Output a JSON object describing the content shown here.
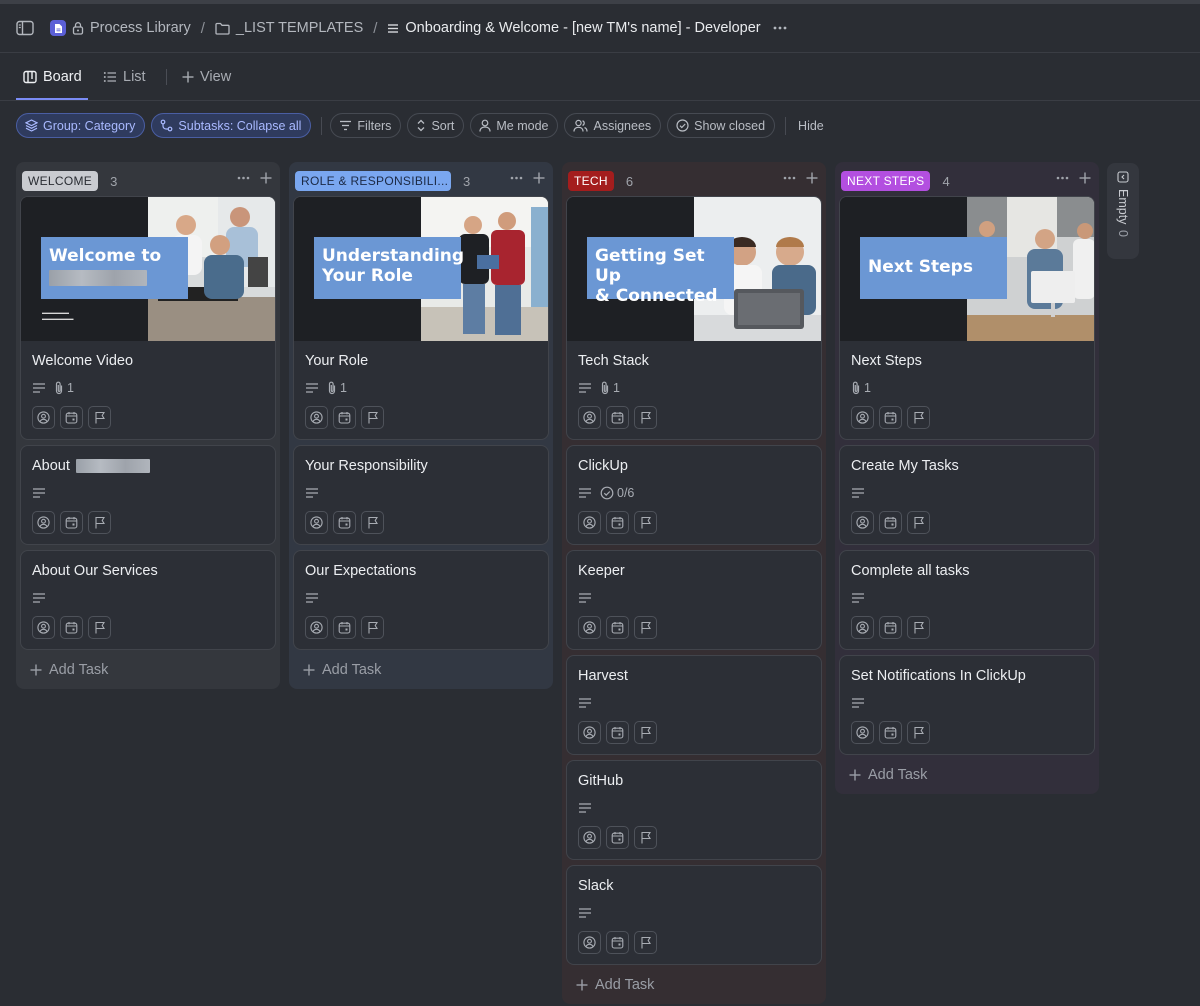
{
  "breadcrumb": {
    "space": "Process Library",
    "folder": "_LIST TEMPLATES",
    "list": "Onboarding & Welcome - [new TM's name] - Developer"
  },
  "views": {
    "board": "Board",
    "list": "List",
    "add_view": "View"
  },
  "toolbar": {
    "group": "Group: Category",
    "subtasks": "Subtasks: Collapse all",
    "filters": "Filters",
    "sort": "Sort",
    "me_mode": "Me mode",
    "assignees": "Assignees",
    "show_closed": "Show closed",
    "hide": "Hide"
  },
  "colors": {
    "accent": "#7b8cf5",
    "welcome": "#c9cbd0",
    "role": "#7aa7f0",
    "tech": "#a41d1d",
    "next_steps": "#b34fe0"
  },
  "add_task_label": "Add Task",
  "columns": [
    {
      "status": "WELCOME",
      "count": "3",
      "cards": [
        {
          "title": "Welcome Video",
          "cover": "Welcome to",
          "attachments": "1"
        },
        {
          "title": "About"
        },
        {
          "title": "About Our Services"
        }
      ]
    },
    {
      "status": "ROLE & RESPONSIBILI...",
      "count": "3",
      "cards": [
        {
          "title": "Your Role",
          "cover_line1": "Understanding",
          "cover_line2": "Your Role",
          "attachments": "1"
        },
        {
          "title": "Your Responsibility"
        },
        {
          "title": "Our Expectations"
        }
      ]
    },
    {
      "status": "TECH",
      "count": "6",
      "cards": [
        {
          "title": "Tech Stack",
          "cover_line1": "Getting Set Up",
          "cover_line2": "& Connected",
          "attachments": "1"
        },
        {
          "title": "ClickUp",
          "checklist": "0/6"
        },
        {
          "title": "Keeper"
        },
        {
          "title": "Harvest"
        },
        {
          "title": "GitHub"
        },
        {
          "title": "Slack"
        }
      ]
    },
    {
      "status": "NEXT STEPS",
      "count": "4",
      "cards": [
        {
          "title": "Next Steps",
          "cover": "Next Steps",
          "attachments": "1"
        },
        {
          "title": "Create My Tasks"
        },
        {
          "title": "Complete all tasks"
        },
        {
          "title": "Set Notifications In ClickUp"
        }
      ]
    }
  ],
  "collapsed_group": {
    "label": "Empty",
    "count": "0"
  }
}
